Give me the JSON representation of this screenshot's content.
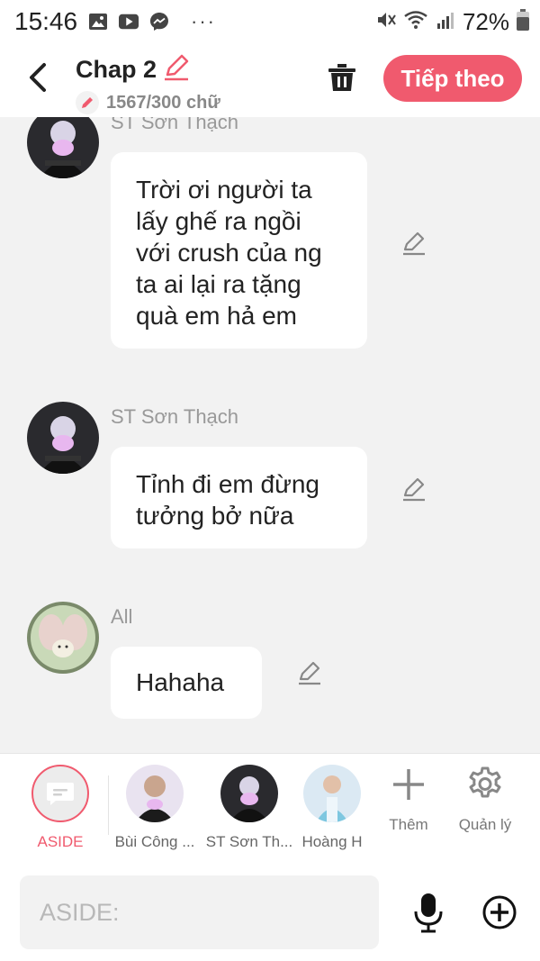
{
  "status_bar": {
    "time": "15:46",
    "more": "···",
    "battery": "72%"
  },
  "header": {
    "title": "Chap 2",
    "word_count": "1567/300 chữ",
    "next_label": "Tiếp theo"
  },
  "messages": [
    {
      "sender": "ST Sơn Thạch",
      "text": "Trời ơi người ta lấy ghế ra ngồi với crush của ng ta ai lại ra tặng quà em hả em"
    },
    {
      "sender": "ST Sơn Thạch",
      "text": "Tỉnh đi em đừng tưởng bở nữa"
    },
    {
      "sender": "All",
      "text": "Hahaha"
    }
  ],
  "characters": {
    "aside_label": "ASIDE",
    "items": [
      {
        "name": "Bùi Công ..."
      },
      {
        "name": "ST Sơn Th..."
      },
      {
        "name": "Hoàng H"
      }
    ],
    "add_label": "Thêm",
    "manage_label": "Quản lý"
  },
  "input": {
    "placeholder": "ASIDE:",
    "value": ""
  },
  "colors": {
    "accent": "#f05a6e",
    "background": "#f2f2f2"
  }
}
